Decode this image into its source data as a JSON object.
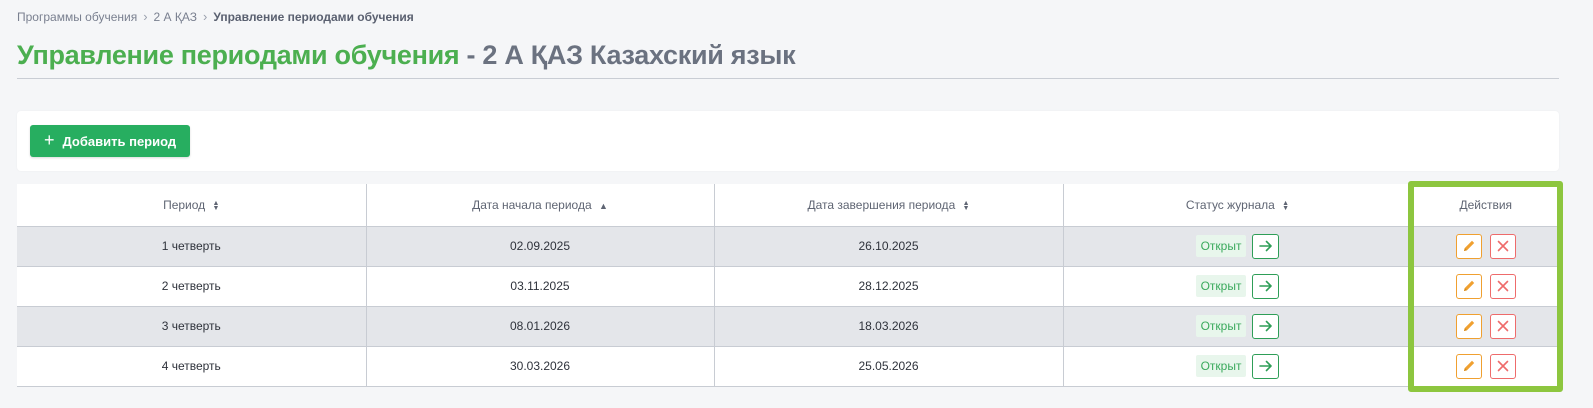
{
  "breadcrumb": {
    "items": [
      "Программы обучения",
      "2 А ҚАЗ"
    ],
    "current": "Управление периодами обучения"
  },
  "page": {
    "title_main": "Управление периодами обучения",
    "title_rest": " - 2 А ҚАЗ Казахский язык"
  },
  "toolbar": {
    "add_label": "Добавить период"
  },
  "table": {
    "columns": [
      "Период",
      "Дата начала периода",
      "Дата завершения периода",
      "Статус журнала",
      "Действия"
    ],
    "rows": [
      {
        "period": "1 четверть",
        "start": "02.09.2025",
        "end": "26.10.2025",
        "status": "Открыт"
      },
      {
        "period": "2 четверть",
        "start": "03.11.2025",
        "end": "28.12.2025",
        "status": "Открыт"
      },
      {
        "period": "3 четверть",
        "start": "08.01.2026",
        "end": "18.03.2026",
        "status": "Открыт"
      },
      {
        "period": "4 четверть",
        "start": "30.03.2026",
        "end": "25.05.2026",
        "status": "Открыт"
      }
    ]
  },
  "colors": {
    "accent_green": "#27ae60",
    "title_green": "#4caf50",
    "edit_orange": "#f0a030",
    "delete_red": "#ee6b6b",
    "highlight": "#8dc63f"
  },
  "icons": {
    "add": "plus-icon",
    "sort_both": "sort-icon",
    "sort_asc": "sort-asc-icon",
    "open_journal": "arrow-right-icon",
    "edit": "pencil-icon",
    "delete": "close-icon"
  }
}
